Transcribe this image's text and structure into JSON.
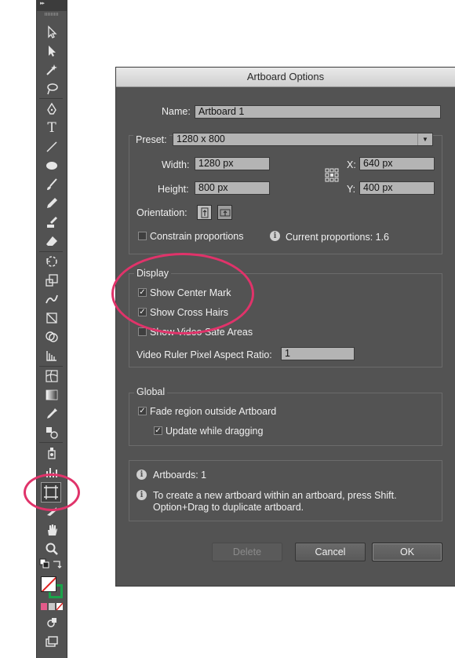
{
  "dialog": {
    "title": "Artboard Options",
    "name_label": "Name:",
    "name_value": "Artboard 1",
    "preset_label": "Preset:",
    "preset_value": "1280 x 800",
    "width_label": "Width:",
    "width_value": "1280 px",
    "height_label": "Height:",
    "height_value": "800 px",
    "x_label": "X:",
    "x_value": "640 px",
    "y_label": "Y:",
    "y_value": "400 px",
    "orientation_label": "Orientation:",
    "constrain_label": "Constrain proportions",
    "constrain_checked": false,
    "current_proportions": "Current proportions: 1.6",
    "display": {
      "title": "Display",
      "center_mark_label": "Show Center Mark",
      "center_mark_checked": true,
      "cross_hairs_label": "Show Cross Hairs",
      "cross_hairs_checked": true,
      "video_safe_label": "Show Video Safe Areas",
      "video_safe_checked": false,
      "pixel_ratio_label": "Video Ruler Pixel Aspect Ratio:",
      "pixel_ratio_value": "1"
    },
    "global": {
      "title": "Global",
      "fade_label": "Fade region outside Artboard",
      "fade_checked": true,
      "update_label": "Update while dragging",
      "update_checked": true
    },
    "info": {
      "artboards": "Artboards: 1",
      "tip_line1": "To create a new artboard within an artboard, press Shift.",
      "tip_line2": "Option+Drag to duplicate artboard."
    },
    "buttons": {
      "delete": "Delete",
      "cancel": "Cancel",
      "ok": "OK"
    }
  },
  "toolbar": {
    "header_glyph": "▸▸",
    "type_tool_glyph": "T",
    "tools": [
      "selection-tool",
      "direct-selection-tool",
      "magic-wand-tool",
      "lasso-tool",
      "pen-tool",
      "type-tool",
      "line-segment-tool",
      "ellipse-tool",
      "paintbrush-tool",
      "pencil-tool",
      "blob-brush-tool",
      "eraser-tool",
      "rotate-tool",
      "scale-tool",
      "warp-tool",
      "free-transform-tool",
      "shape-builder-tool",
      "graph-tool",
      "mesh-tool",
      "gradient-tool",
      "eyedropper-tool",
      "blend-tool",
      "symbol-sprayer-tool",
      "column-graph-tool",
      "artboard-tool",
      "slice-tool",
      "hand-tool",
      "zoom-tool",
      "fill-stroke-swatches",
      "color-mode-buttons",
      "draw-mode",
      "screen-mode"
    ]
  },
  "colors": {
    "highlight": "#e0336a",
    "dialog_bg": "#535353",
    "field_bg": "#b4b4b4",
    "stroke_green": "#1aa34a"
  },
  "check_mark": "✓"
}
